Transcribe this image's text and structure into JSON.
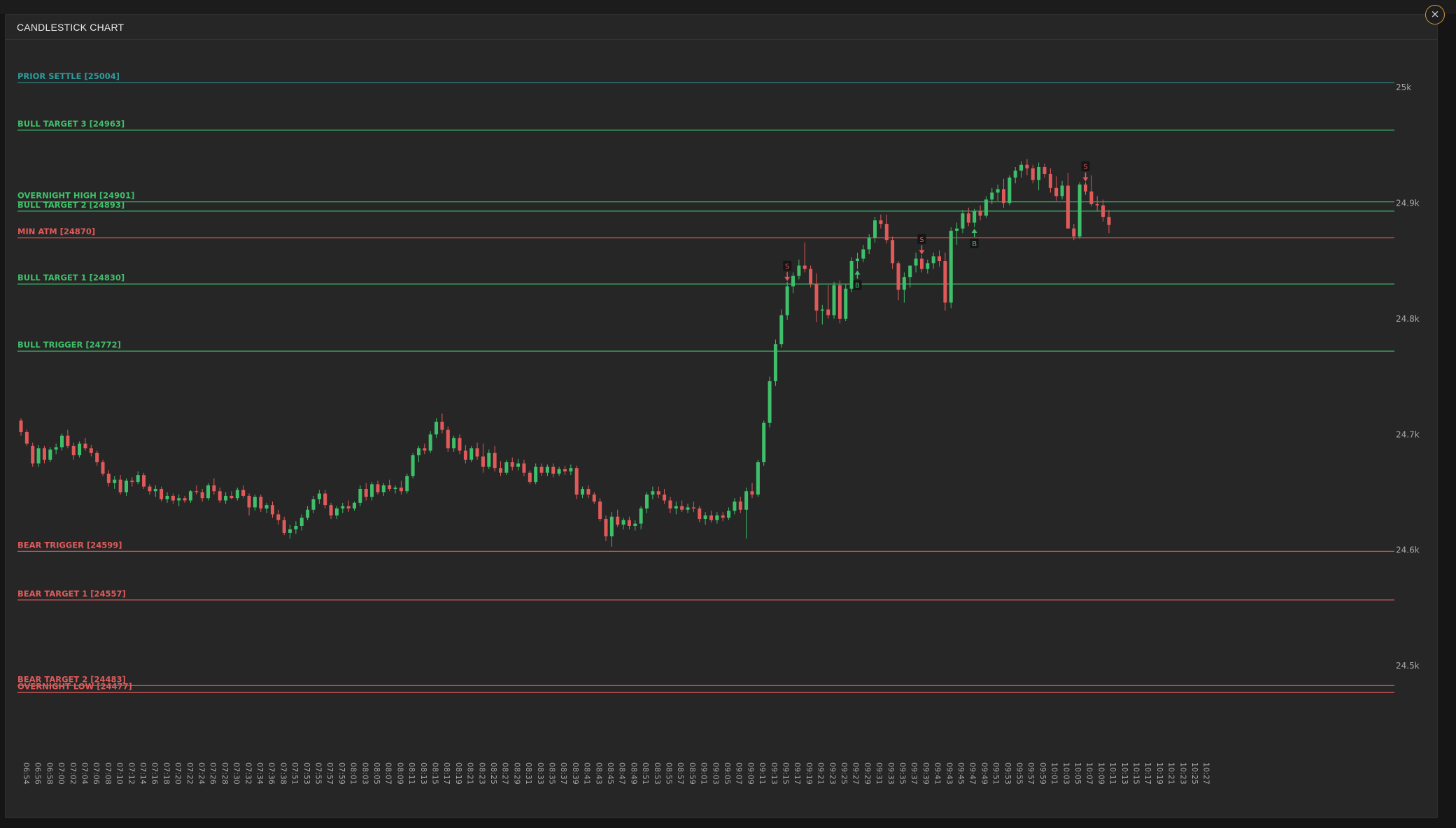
{
  "modal": {
    "title": "CANDLESTICK CHART",
    "close_icon": "×"
  },
  "colors": {
    "background": "#262626",
    "bull": "#3fbf6a",
    "bear": "#e05a5a",
    "settle": "#2f9b9b",
    "axis_text": "#a8a8a8",
    "signal_box": "#151515"
  },
  "chart_data": {
    "type": "candlestick",
    "title": "CANDLESTICK CHART",
    "ylim": [
      24453,
      25015
    ],
    "y_ticks": [
      {
        "value": 25000,
        "label": "25k"
      },
      {
        "value": 24900,
        "label": "24.9k"
      },
      {
        "value": 24800,
        "label": "24.8k"
      },
      {
        "value": 24700,
        "label": "24.7k"
      },
      {
        "value": 24600,
        "label": "24.6k"
      },
      {
        "value": 24500,
        "label": "24.5k"
      }
    ],
    "x_tick_labels": [
      "06:54",
      "06:56",
      "06:58",
      "07:00",
      "07:02",
      "07:04",
      "07:06",
      "07:08",
      "07:10",
      "07:12",
      "07:14",
      "07:16",
      "07:18",
      "07:20",
      "07:22",
      "07:24",
      "07:26",
      "07:28",
      "07:30",
      "07:32",
      "07:34",
      "07:36",
      "07:38",
      "07:51",
      "07:53",
      "07:55",
      "07:57",
      "07:59",
      "08:01",
      "08:03",
      "08:05",
      "08:07",
      "08:09",
      "08:11",
      "08:13",
      "08:15",
      "08:17",
      "08:19",
      "08:21",
      "08:23",
      "08:25",
      "08:27",
      "08:29",
      "08:31",
      "08:33",
      "08:35",
      "08:37",
      "08:39",
      "08:41",
      "08:43",
      "08:45",
      "08:47",
      "08:49",
      "08:51",
      "08:53",
      "08:55",
      "08:57",
      "08:59",
      "09:01",
      "09:03",
      "09:05",
      "09:07",
      "09:09",
      "09:11",
      "09:13",
      "09:15",
      "09:17",
      "09:19",
      "09:21",
      "09:23",
      "09:25",
      "09:27",
      "09:29",
      "09:31",
      "09:33",
      "09:35",
      "09:37",
      "09:39",
      "09:41",
      "09:43",
      "09:45",
      "09:47",
      "09:49",
      "09:51",
      "09:53",
      "09:55",
      "09:57",
      "09:59",
      "10:01",
      "10:03",
      "10:05",
      "10:07",
      "10:09",
      "10:11",
      "10:13",
      "10:15",
      "10:17",
      "10:19",
      "10:21",
      "10:23",
      "10:25",
      "10:27"
    ],
    "level_lines": [
      {
        "label": "PRIOR SETTLE [25004]",
        "value": 25004,
        "kind": "settle"
      },
      {
        "label": "BULL TARGET 3 [24963]",
        "value": 24963,
        "kind": "bull"
      },
      {
        "label": "OVERNIGHT HIGH [24901]",
        "value": 24901,
        "kind": "bull"
      },
      {
        "label": "BULL TARGET 2 [24893]",
        "value": 24893,
        "kind": "bull"
      },
      {
        "label": "MIN ATM [24870]",
        "value": 24870,
        "kind": "bear"
      },
      {
        "label": "BULL TARGET 1 [24830]",
        "value": 24830,
        "kind": "bull"
      },
      {
        "label": "BULL TRIGGER [24772]",
        "value": 24772,
        "kind": "bull"
      },
      {
        "label": "BEAR TRIGGER [24599]",
        "value": 24599,
        "kind": "bear"
      },
      {
        "label": "BEAR TARGET 1 [24557]",
        "value": 24557,
        "kind": "bear"
      },
      {
        "label": "BEAR TARGET 2 [24483]",
        "value": 24483,
        "kind": "bear"
      },
      {
        "label": "OVERNIGHT LOW [24477]",
        "value": 24477,
        "kind": "bear"
      }
    ],
    "candles_ohlc": [
      [
        24712,
        24714,
        24699,
        24702
      ],
      [
        24702,
        24704,
        24690,
        24692
      ],
      [
        24690,
        24693,
        24672,
        24675
      ],
      [
        24675,
        24691,
        24672,
        24688
      ],
      [
        24688,
        24690,
        24675,
        24678
      ],
      [
        24678,
        24689,
        24676,
        24687
      ],
      [
        24687,
        24692,
        24683,
        24689
      ],
      [
        24689,
        24701,
        24686,
        24699
      ],
      [
        24699,
        24704,
        24688,
        24690
      ],
      [
        24690,
        24693,
        24678,
        24682
      ],
      [
        24682,
        24694,
        24680,
        24692
      ],
      [
        24692,
        24697,
        24686,
        24688
      ],
      [
        24688,
        24691,
        24681,
        24684
      ],
      [
        24684,
        24686,
        24673,
        24676
      ],
      [
        24676,
        24678,
        24664,
        24666
      ],
      [
        24666,
        24669,
        24655,
        24658
      ],
      [
        24658,
        24664,
        24653,
        24661
      ],
      [
        24661,
        24665,
        24648,
        24650
      ],
      [
        24650,
        24662,
        24647,
        24660
      ],
      [
        24660,
        24663,
        24655,
        24659
      ],
      [
        24659,
        24668,
        24657,
        24665
      ],
      [
        24665,
        24667,
        24653,
        24655
      ],
      [
        24655,
        24657,
        24648,
        24651
      ],
      [
        24651,
        24656,
        24646,
        24653
      ],
      [
        24653,
        24655,
        24642,
        24644
      ],
      [
        24644,
        24650,
        24641,
        24647
      ],
      [
        24647,
        24649,
        24640,
        24643
      ],
      [
        24643,
        24648,
        24638,
        24645
      ],
      [
        24645,
        24647,
        24641,
        24643
      ],
      [
        24643,
        24652,
        24641,
        24651
      ],
      [
        24651,
        24656,
        24648,
        24650
      ],
      [
        24650,
        24653,
        24642,
        24645
      ],
      [
        24645,
        24658,
        24643,
        24656
      ],
      [
        24656,
        24662,
        24648,
        24651
      ],
      [
        24651,
        24654,
        24641,
        24643
      ],
      [
        24643,
        24650,
        24640,
        24647
      ],
      [
        24647,
        24651,
        24644,
        24645
      ],
      [
        24645,
        24654,
        24643,
        24652
      ],
      [
        24652,
        24656,
        24645,
        24647
      ],
      [
        24647,
        24649,
        24630,
        24637
      ],
      [
        24637,
        24648,
        24634,
        24646
      ],
      [
        24646,
        24648,
        24633,
        24636
      ],
      [
        24636,
        24641,
        24632,
        24639
      ],
      [
        24639,
        24642,
        24628,
        24631
      ],
      [
        24631,
        24635,
        24622,
        24626
      ],
      [
        24626,
        24629,
        24613,
        24615
      ],
      [
        24615,
        24622,
        24610,
        24618
      ],
      [
        24618,
        24625,
        24614,
        24621
      ],
      [
        24621,
        24631,
        24617,
        24628
      ],
      [
        24628,
        24638,
        24626,
        24635
      ],
      [
        24635,
        24647,
        24632,
        24644
      ],
      [
        24644,
        24652,
        24640,
        24649
      ],
      [
        24649,
        24652,
        24636,
        24639
      ],
      [
        24639,
        24641,
        24627,
        24630
      ],
      [
        24630,
        24638,
        24627,
        24636
      ],
      [
        24636,
        24641,
        24632,
        24638
      ],
      [
        24638,
        24643,
        24633,
        24636
      ],
      [
        24636,
        24642,
        24634,
        24641
      ],
      [
        24641,
        24656,
        24638,
        24653
      ],
      [
        24653,
        24658,
        24643,
        24646
      ],
      [
        24646,
        24659,
        24643,
        24657
      ],
      [
        24657,
        24660,
        24648,
        24650
      ],
      [
        24650,
        24658,
        24647,
        24656
      ],
      [
        24656,
        24661,
        24651,
        24653
      ],
      [
        24653,
        24656,
        24649,
        24654
      ],
      [
        24654,
        24660,
        24648,
        24651
      ],
      [
        24651,
        24666,
        24649,
        24664
      ],
      [
        24664,
        24684,
        24662,
        24682
      ],
      [
        24682,
        24690,
        24676,
        24688
      ],
      [
        24688,
        24692,
        24683,
        24686
      ],
      [
        24686,
        24703,
        24684,
        24700
      ],
      [
        24700,
        24714,
        24697,
        24711
      ],
      [
        24711,
        24718,
        24701,
        24704
      ],
      [
        24704,
        24707,
        24685,
        24688
      ],
      [
        24688,
        24699,
        24685,
        24697
      ],
      [
        24697,
        24700,
        24683,
        24686
      ],
      [
        24686,
        24691,
        24675,
        24678
      ],
      [
        24678,
        24690,
        24676,
        24688
      ],
      [
        24688,
        24693,
        24678,
        24681
      ],
      [
        24681,
        24692,
        24667,
        24672
      ],
      [
        24672,
        24687,
        24670,
        24684
      ],
      [
        24684,
        24690,
        24668,
        24671
      ],
      [
        24671,
        24677,
        24664,
        24667
      ],
      [
        24667,
        24678,
        24665,
        24676
      ],
      [
        24676,
        24680,
        24669,
        24672
      ],
      [
        24672,
        24679,
        24669,
        24675
      ],
      [
        24675,
        24678,
        24664,
        24667
      ],
      [
        24667,
        24669,
        24657,
        24659
      ],
      [
        24659,
        24675,
        24657,
        24672
      ],
      [
        24672,
        24675,
        24664,
        24667
      ],
      [
        24667,
        24674,
        24664,
        24672
      ],
      [
        24672,
        24675,
        24663,
        24666
      ],
      [
        24666,
        24672,
        24664,
        24670
      ],
      [
        24670,
        24673,
        24665,
        24668
      ],
      [
        24668,
        24674,
        24665,
        24671
      ],
      [
        24671,
        24673,
        24644,
        24648
      ],
      [
        24648,
        24655,
        24645,
        24653
      ],
      [
        24653,
        24656,
        24645,
        24648
      ],
      [
        24648,
        24650,
        24640,
        24642
      ],
      [
        24642,
        24645,
        24625,
        24627
      ],
      [
        24627,
        24630,
        24608,
        24612
      ],
      [
        24612,
        24633,
        24603,
        24629
      ],
      [
        24629,
        24635,
        24620,
        24622
      ],
      [
        24622,
        24628,
        24618,
        24626
      ],
      [
        24626,
        24629,
        24618,
        24621
      ],
      [
        24621,
        24626,
        24617,
        24623
      ],
      [
        24623,
        24638,
        24618,
        24636
      ],
      [
        24636,
        24650,
        24632,
        24648
      ],
      [
        24648,
        24655,
        24644,
        24651
      ],
      [
        24651,
        24655,
        24645,
        24648
      ],
      [
        24648,
        24653,
        24640,
        24643
      ],
      [
        24643,
        24646,
        24632,
        24636
      ],
      [
        24636,
        24642,
        24631,
        24638
      ],
      [
        24638,
        24643,
        24633,
        24635
      ],
      [
        24635,
        24640,
        24632,
        24637
      ],
      [
        24637,
        24642,
        24633,
        24636
      ],
      [
        24636,
        24638,
        24624,
        24627
      ],
      [
        24627,
        24633,
        24622,
        24630
      ],
      [
        24630,
        24634,
        24624,
        24626
      ],
      [
        24626,
        24633,
        24623,
        24630
      ],
      [
        24630,
        24633,
        24625,
        24628
      ],
      [
        24628,
        24637,
        24626,
        24634
      ],
      [
        24634,
        24645,
        24631,
        24642
      ],
      [
        24642,
        24646,
        24632,
        24635
      ],
      [
        24635,
        24654,
        24610,
        24651
      ],
      [
        24651,
        24658,
        24645,
        24648
      ],
      [
        24648,
        24678,
        24646,
        24676
      ],
      [
        24676,
        24712,
        24673,
        24710
      ],
      [
        24710,
        24750,
        24706,
        24746
      ],
      [
        24746,
        24782,
        24742,
        24778
      ],
      [
        24778,
        24808,
        24775,
        24803
      ],
      [
        24803,
        24832,
        24799,
        24828
      ],
      [
        24828,
        24840,
        24822,
        24837
      ],
      [
        24837,
        24851,
        24834,
        24846
      ],
      [
        24846,
        24866,
        24840,
        24843
      ],
      [
        24843,
        24846,
        24827,
        24830
      ],
      [
        24830,
        24839,
        24797,
        24807
      ],
      [
        24807,
        24812,
        24795,
        24808
      ],
      [
        24808,
        24829,
        24800,
        24803
      ],
      [
        24803,
        24832,
        24800,
        24829
      ],
      [
        24829,
        24833,
        24796,
        24800
      ],
      [
        24800,
        24830,
        24798,
        24826
      ],
      [
        24826,
        24853,
        24823,
        24850
      ],
      [
        24850,
        24857,
        24843,
        24852
      ],
      [
        24852,
        24864,
        24849,
        24860
      ],
      [
        24860,
        24873,
        24856,
        24870
      ],
      [
        24870,
        24888,
        24866,
        24885
      ],
      [
        24885,
        24890,
        24878,
        24882
      ],
      [
        24882,
        24890,
        24865,
        24868
      ],
      [
        24868,
        24871,
        24843,
        24848
      ],
      [
        24848,
        24850,
        24816,
        24825
      ],
      [
        24825,
        24840,
        24814,
        24836
      ],
      [
        24836,
        24843,
        24827,
        24846
      ],
      [
        24846,
        24857,
        24840,
        24852
      ],
      [
        24852,
        24855,
        24840,
        24843
      ],
      [
        24843,
        24851,
        24839,
        24848
      ],
      [
        24848,
        24857,
        24843,
        24854
      ],
      [
        24854,
        24859,
        24845,
        24850
      ],
      [
        24850,
        24857,
        24807,
        24814
      ],
      [
        24814,
        24879,
        24809,
        24876
      ],
      [
        24876,
        24883,
        24864,
        24878
      ],
      [
        24878,
        24894,
        24874,
        24891
      ],
      [
        24891,
        24896,
        24880,
        24883
      ],
      [
        24883,
        24895,
        24879,
        24893
      ],
      [
        24893,
        24898,
        24885,
        24889
      ],
      [
        24889,
        24906,
        24887,
        24903
      ],
      [
        24903,
        24913,
        24899,
        24909
      ],
      [
        24909,
        24916,
        24902,
        24912
      ],
      [
        24912,
        24921,
        24896,
        24900
      ],
      [
        24900,
        24924,
        24898,
        24922
      ],
      [
        24922,
        24931,
        24917,
        24928
      ],
      [
        24928,
        24936,
        24922,
        24933
      ],
      [
        24933,
        24938,
        24924,
        24930
      ],
      [
        24930,
        24933,
        24917,
        24920
      ],
      [
        24920,
        24935,
        24911,
        24931
      ],
      [
        24931,
        24934,
        24922,
        24925
      ],
      [
        24925,
        24930,
        24909,
        24913
      ],
      [
        24913,
        24923,
        24902,
        24906
      ],
      [
        24906,
        24919,
        24903,
        24915
      ],
      [
        24915,
        24926,
        24886,
        24878
      ],
      [
        24878,
        24882,
        24868,
        24871
      ],
      [
        24871,
        24918,
        24869,
        24916
      ],
      [
        24916,
        24918,
        24907,
        24910
      ],
      [
        24910,
        24924,
        24897,
        24899
      ],
      [
        24899,
        24906,
        24893,
        24898
      ],
      [
        24898,
        24903,
        24884,
        24888
      ],
      [
        24888,
        24894,
        24874,
        24881
      ]
    ],
    "signals": [
      {
        "label": "S",
        "candle": 131,
        "kind": "sell"
      },
      {
        "label": "B",
        "candle": 143,
        "kind": "buy"
      },
      {
        "label": "S",
        "candle": 154,
        "kind": "sell"
      },
      {
        "label": "B",
        "candle": 163,
        "kind": "buy"
      },
      {
        "label": "S",
        "candle": 182,
        "kind": "sell"
      }
    ]
  }
}
